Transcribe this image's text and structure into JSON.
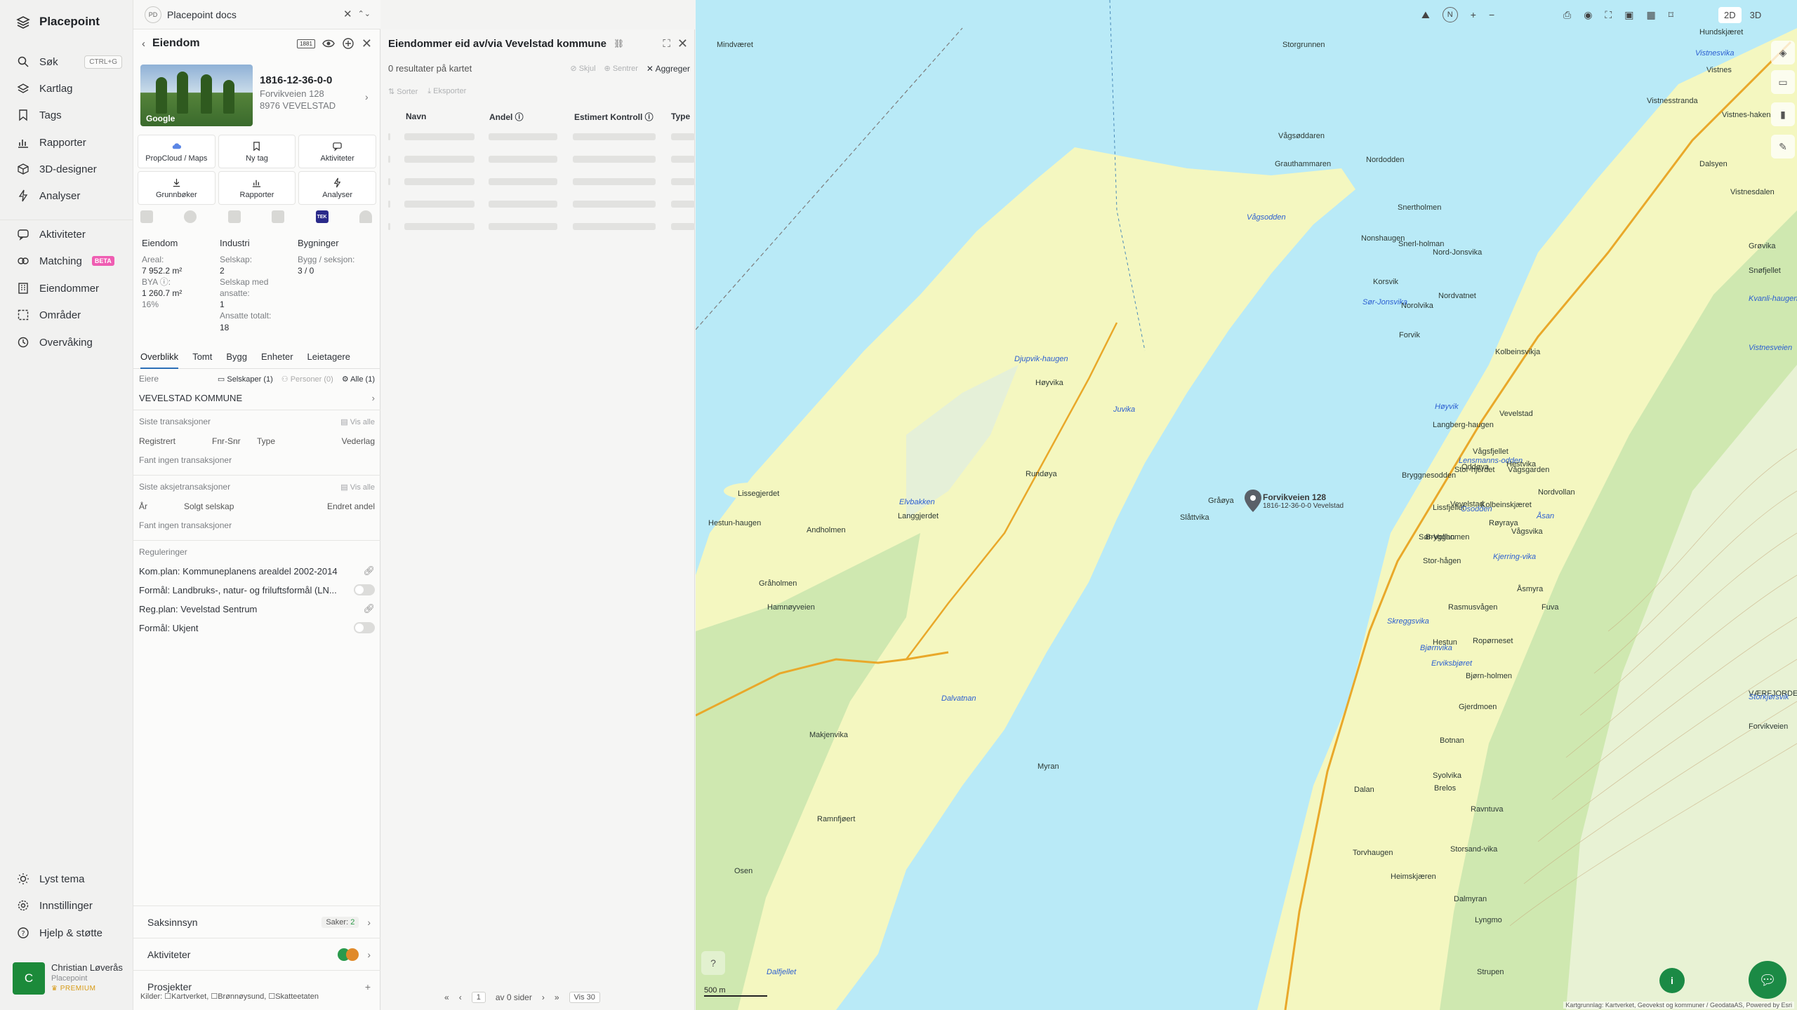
{
  "app": {
    "brand": "Placepoint"
  },
  "nav": {
    "items": [
      {
        "label": "Søk",
        "shortcut": "CTRL+G",
        "icon": "search-icon"
      },
      {
        "label": "Kartlag",
        "icon": "layers-icon"
      },
      {
        "label": "Tags",
        "icon": "bookmark-icon"
      },
      {
        "label": "Rapporter",
        "icon": "chart-icon"
      },
      {
        "label": "3D-designer",
        "icon": "cube-icon"
      },
      {
        "label": "Analyser",
        "icon": "bolt-icon"
      },
      {
        "label": "Aktiviteter",
        "icon": "chat-icon"
      },
      {
        "label": "Matching",
        "badge": "BETA",
        "icon": "match-icon"
      },
      {
        "label": "Eiendommer",
        "icon": "building-icon"
      },
      {
        "label": "Områder",
        "icon": "area-icon"
      },
      {
        "label": "Overvåking",
        "icon": "eye-icon"
      }
    ],
    "bottom": [
      {
        "label": "Lyst tema",
        "icon": "sun-icon"
      },
      {
        "label": "Innstillinger",
        "icon": "gear-icon"
      },
      {
        "label": "Hjelp & støtte",
        "icon": "help-icon"
      }
    ],
    "user": {
      "initial": "C",
      "name": "Christian Løverås",
      "org": "Placepoint",
      "tier": "PREMIUM"
    }
  },
  "docs": {
    "avatar": "PD",
    "title": "Placepoint docs"
  },
  "property": {
    "header": "Eiendom",
    "badge": "1881",
    "photo_label": "Google",
    "id": "1816-12-36-0-0",
    "address1": "Forvikveien 128",
    "address2": "8976 VEVELSTAD",
    "actions": [
      {
        "label": "PropCloud / Maps",
        "icon": "cloud-icon"
      },
      {
        "label": "Ny tag",
        "icon": "bookmark-icon"
      },
      {
        "label": "Aktiviteter",
        "icon": "chat-icon"
      },
      {
        "label": "Grunnbøker",
        "icon": "download-icon"
      },
      {
        "label": "Rapporter",
        "icon": "chart-icon"
      },
      {
        "label": "Analyser",
        "icon": "bolt-icon"
      }
    ],
    "source_tek": "TEK",
    "stats": {
      "eiendom": {
        "title": "Eiendom",
        "areal_k": "Areal:",
        "areal_v": "7 952.2 m²",
        "bya_k": "BYA ⓘ:",
        "bya_v": "1 260.7 m²",
        "bya_pct": "16%"
      },
      "industri": {
        "title": "Industri",
        "selskap_k": "Selskap:",
        "selskap_v": "2",
        "med_k": "Selskap med ansatte:",
        "med_v": "1",
        "ans_k": "Ansatte totalt:",
        "ans_v": "18"
      },
      "bygninger": {
        "title": "Bygninger",
        "bygg_k": "Bygg / seksjon:",
        "bygg_v": "3 / 0"
      }
    },
    "tabs": [
      "Overblikk",
      "Tomt",
      "Bygg",
      "Enheter",
      "Leietagere"
    ],
    "owners": {
      "label": "Eiere",
      "f1": "Selskaper (1)",
      "f2": "Personer (0)",
      "f3": "Alle (1)",
      "owner": "VEVELSTAD KOMMUNE"
    },
    "transactions": {
      "label": "Siste transaksjoner",
      "link": "Vis alle",
      "cols": [
        "Registrert",
        "Fnr-Snr",
        "Type",
        "Vederlag"
      ],
      "empty": "Fant ingen transaksjoner"
    },
    "share_tx": {
      "label": "Siste aksjetransaksjoner",
      "link": "Vis alle",
      "cols": [
        "År",
        "Solgt selskap",
        "Endret andel"
      ],
      "empty": "Fant ingen transaksjoner"
    },
    "regulations": {
      "label": "Reguleringer",
      "kom": "Kom.plan: Kommuneplanens arealdel 2002-2014",
      "formal1": "Formål: Landbruks-, natur- og friluftsformål (LN...",
      "reg": "Reg.plan: Vevelstad Sentrum",
      "formal2": "Formål: Ukjent"
    },
    "saksinnsyn": {
      "label": "Saksinnsyn",
      "count_label": "Saker:",
      "count": "2"
    },
    "aktiviteter": "Aktiviteter",
    "prosjekter": "Prosjekter",
    "sources": "Kilder: ☐Kartverket, ☐Brønnøysund, ☐Skatteetaten"
  },
  "table": {
    "title": "Eiendommer eid av/via Vevelstad kommune",
    "count": "0 resultater på kartet",
    "hide": "Skjul",
    "center": "Sentrer",
    "aggregate": "Aggreger",
    "sort": "Sorter",
    "export": "Eksporter",
    "columns": [
      "Navn",
      "Andel ⓘ",
      "Estimert Kontroll ⓘ",
      "Type"
    ],
    "pager": {
      "page": "1",
      "of": "av 0 sider",
      "per": "Vis 30"
    }
  },
  "map": {
    "view2d": "2D",
    "view3d": "3D",
    "north": "N",
    "zoom_in": "+",
    "zoom_out": "−",
    "scale": "500 m",
    "credit": "Kartgrunnlag: Kartverket, Geovekst og kommuner / GeodataAS, Powered by Esri",
    "pin_label1": "Forvikveien 128",
    "pin_label2": "1816-12-36-0-0 Vevelstad",
    "places": [
      "Mindværet",
      "Storgrunnen",
      "Vistnesvika",
      "Vistnes",
      "Hundskjæret",
      "Vistnesstranda",
      "Vistnes-haken",
      "Dalsyen",
      "Vistnesdalen",
      "Vågsøddaren",
      "Nordodden",
      "Grauthammaren",
      "Snertholmen",
      "Vågsodden",
      "Nord-Jonsvika",
      "Nonshaugen",
      "Snerl-holman",
      "Korsvik",
      "Sør-Jonsvika",
      "Nordvatnet",
      "Norolvika",
      "Forvik",
      "Kolbeinsvikja",
      "Djupvik-haugen",
      "Høyvika",
      "Juvika",
      "Høyvik",
      "Langberg-haugen",
      "Vevelstad",
      "Vågsfjellet",
      "Lensmanns-odden",
      "Oddøya",
      "Hestvika",
      "Stor-hjerdet",
      "Vågsgarden",
      "Rundøya",
      "Bryggnesodden",
      "Lissegjerdet",
      "Elvbakken",
      "Vevelstad",
      "Gråøya",
      "Kolbeinskjæret",
      "Langgjerdet",
      "Lissfjellet",
      "Osodden",
      "Nordvollan",
      "Røyraya",
      "Hestun-haugen",
      "Sør-Vollan",
      "Andholmen",
      "Vågsvika",
      "Slåttvika",
      "Åsan",
      "Kjerring-vika",
      "Brygghomen",
      "Stor-hågen",
      "Åsmyra",
      "Gråholmen",
      "Rasmusvågen",
      "Fuva",
      "Bjørnvika",
      "Ropørneset",
      "Hestun",
      "Skreggsvika",
      "Hamnøyveien",
      "Bjørn-holmen",
      "Erviksbjøret",
      "Gjerdmoen",
      "Makjenvika",
      "Syolvika",
      "Botnan",
      "Brelos",
      "Ravntuva",
      "Ramnfjøert",
      "Dalan",
      "Torvhaugen",
      "Storsand-vika",
      "Osen",
      "Heimskjæren",
      "Dalmyran",
      "Lyngmo",
      "Dalfjellet",
      "Strupen",
      "Grøvika",
      "Snøfjellet",
      "Kvanli-haugen",
      "Vistnesveien",
      "Forvikveien",
      "VÆRFJORDEN",
      "Storkjørsvik",
      "Dalvatnan",
      "Myran"
    ]
  }
}
